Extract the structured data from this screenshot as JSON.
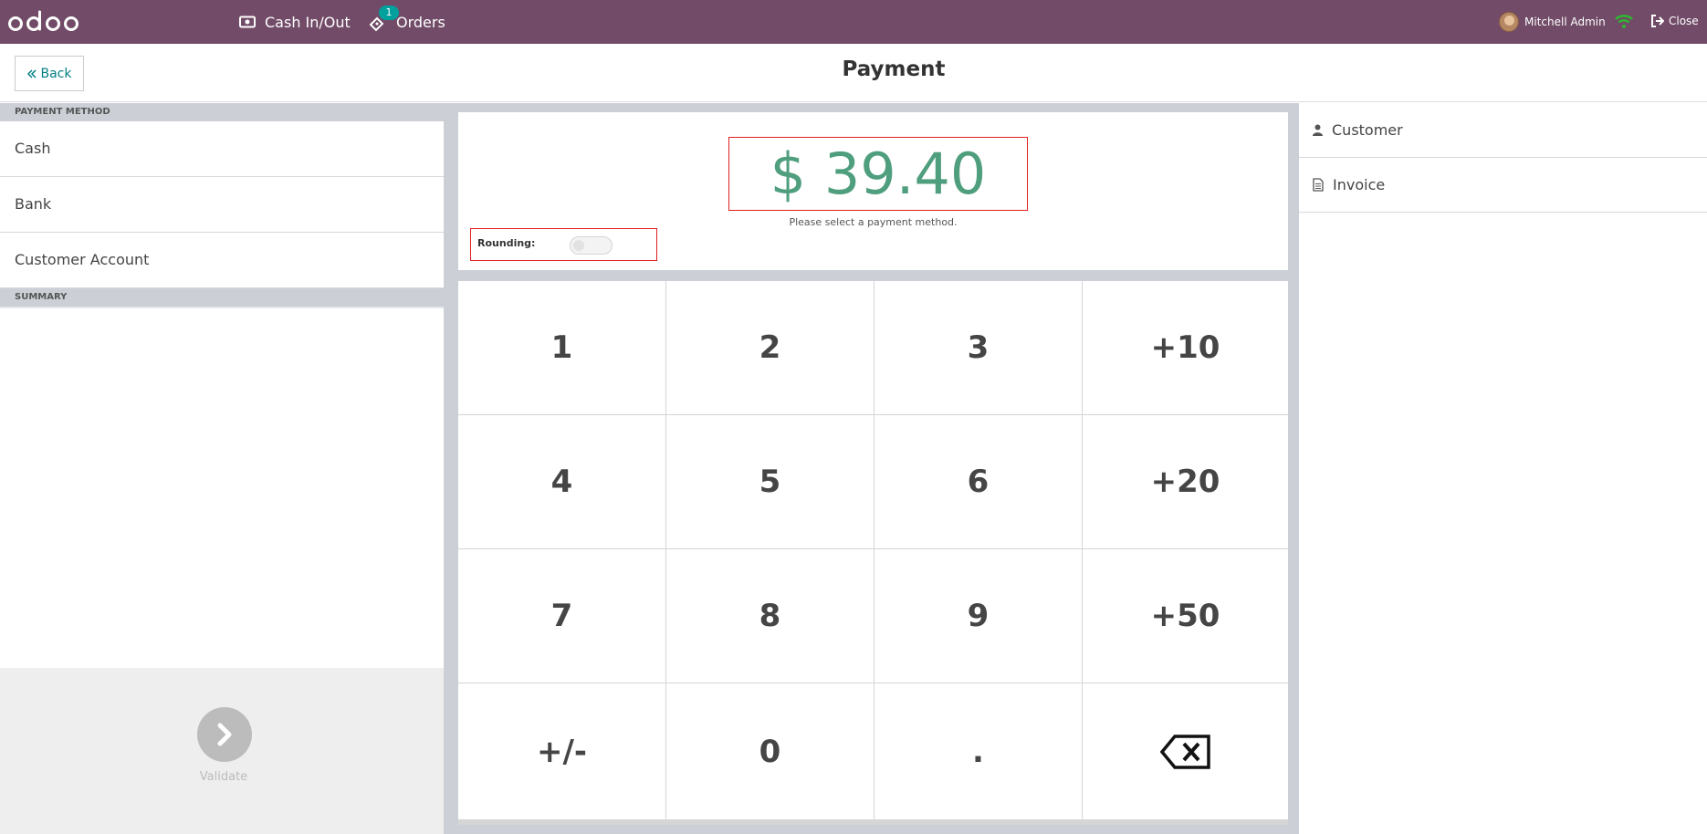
{
  "topbar": {
    "brand": "odoo",
    "cash_label": "Cash In/Out",
    "orders_label": "Orders",
    "orders_badge": "1",
    "user_name": "Mitchell Admin",
    "close_label": "Close"
  },
  "header": {
    "back_label": "Back",
    "title": "Payment"
  },
  "payment_methods": {
    "heading": "PAYMENT METHOD",
    "items": [
      "Cash",
      "Bank",
      "Customer Account"
    ]
  },
  "summary": {
    "heading": "SUMMARY"
  },
  "validate": {
    "label": "Validate"
  },
  "amount": {
    "value": "$ 39.40",
    "hint": "Please select a payment method."
  },
  "rounding": {
    "label": "Rounding:",
    "enabled": false
  },
  "numpad": {
    "keys": [
      "1",
      "2",
      "3",
      "+10",
      "4",
      "5",
      "6",
      "+20",
      "7",
      "8",
      "9",
      "+50",
      "+/-",
      "0",
      ".",
      "backspace"
    ]
  },
  "right_panel": {
    "customer_label": "Customer",
    "invoice_label": "Invoice"
  },
  "colors": {
    "brand": "#714b67",
    "amount": "#4f9e7e",
    "accent": "#017e84",
    "badge": "#00a09d",
    "highlight": "#e02020"
  }
}
